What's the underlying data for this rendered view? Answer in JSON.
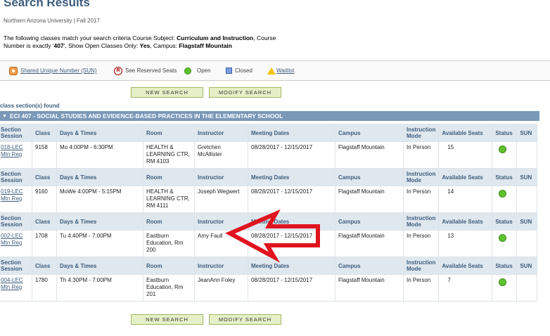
{
  "header": {
    "title": "Search Results",
    "subtitle": "Northern Arizona University | Fall 2017",
    "criteria_prefix": "The following classes match your search criteria Course Subject: ",
    "criteria_subject": "Curriculum and Instruction",
    "criteria_number_prefix": ",  Course Number is exactly '",
    "criteria_number": "407",
    "criteria_open_prefix": "',  Show Open Classes Only: ",
    "criteria_open": "Yes",
    "criteria_campus_prefix": ",  Campus: ",
    "criteria_campus": "Flagstaff Mountain"
  },
  "legend": {
    "sun": "Shared Unique Number (SUN)",
    "reserved": "See Reserved Seats",
    "open": "Open",
    "closed": "Closed",
    "waitlist": "Waitlist",
    "colors": {
      "open": "#5ec22e",
      "closed": "#7b9ee0",
      "waitlist": "#f5c400",
      "reserved": "#aa0000",
      "sun": "#f0a050"
    }
  },
  "buttons": {
    "new_search": "New Search",
    "modify_search": "Modify Search"
  },
  "results": {
    "found": "class section(s) found",
    "course_title": "ECI 407 - SOCIAL STUDIES AND EVIDENCE-BASED PRACTICES IN THE ELEMENTARY SCHOOL"
  },
  "columns": [
    "Section Session",
    "Class",
    "Days & Times",
    "Room",
    "Instructor",
    "Meeting Dates",
    "Campus",
    "Instruction Mode",
    "Available Seats",
    "Status",
    "SUN"
  ],
  "sections": [
    {
      "section": "018-LEC",
      "session": "Mtn Reg",
      "class": "9158",
      "days_times": "Mo 4:00PM - 6:30PM",
      "room": "HEALTH & LEARNING CTR, RM 4103",
      "instructor": "Gretchen McAllister",
      "dates": "08/28/2017 - 12/15/2017",
      "campus": "Flagstaff Mountain",
      "mode": "In Person",
      "seats": "15",
      "status": "open",
      "sun": ""
    },
    {
      "section": "019-LEC",
      "session": "Mtn Reg",
      "class": "9160",
      "days_times": "MoWe 4:00PM - 5:15PM",
      "room": "HEALTH & LEARNING CTR, RM 4111",
      "instructor": "Joseph Wegwert",
      "dates": "08/28/2017 - 12/15/2017",
      "campus": "Flagstaff Mountain",
      "mode": "In Person",
      "seats": "14",
      "status": "open",
      "sun": ""
    },
    {
      "section": "002-LEC",
      "session": "Mtn Reg",
      "class": "1708",
      "days_times": "Tu 4:40PM - 7:00PM",
      "room": "Eastburn Education, Rm 200",
      "instructor": "Amy Faull",
      "dates": "08/28/2017 - 12/15/2017",
      "campus": "Flagstaff Mountain",
      "mode": "In Person",
      "seats": "13",
      "status": "open",
      "sun": ""
    },
    {
      "section": "004-LEC",
      "session": "Mtn Reg",
      "class": "1780",
      "days_times": "Th 4:30PM - 7:00PM",
      "room": "Eastburn Education, Rm 201",
      "instructor": "JeanAnn Foley",
      "dates": "08/28/2017 - 12/15/2017",
      "campus": "Flagstaff Mountain",
      "mode": "In Person",
      "seats": "7",
      "status": "open",
      "sun": ""
    }
  ],
  "annotation": {
    "arrow_color": "#e0141e"
  }
}
